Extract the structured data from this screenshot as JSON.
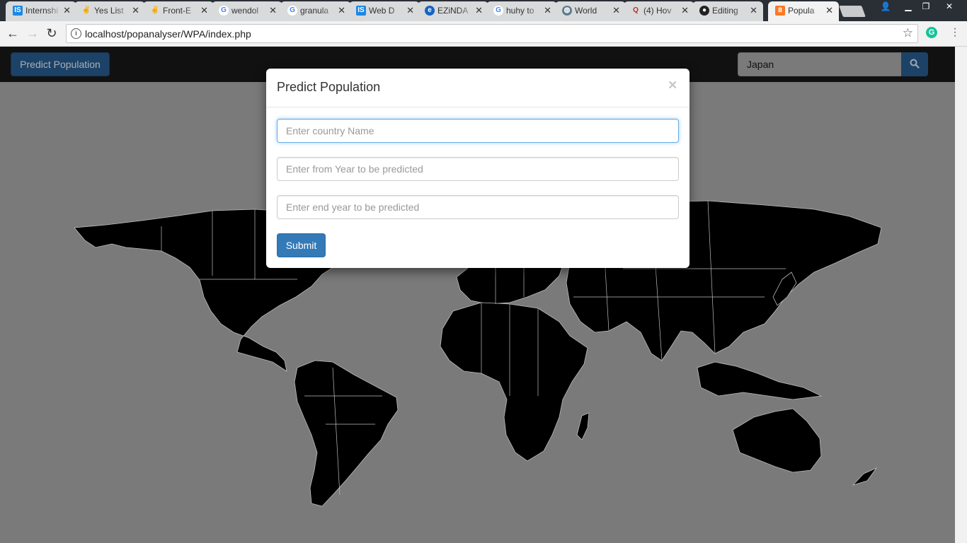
{
  "browser": {
    "tabs": [
      {
        "title": "Internshi",
        "icon": "is-logo-icon",
        "color": "#1e88e5"
      },
      {
        "title": "Yes List",
        "icon": "angellist-icon",
        "color": "#333333"
      },
      {
        "title": "Front-E",
        "icon": "angellist-icon",
        "color": "#333333"
      },
      {
        "title": "wendol",
        "icon": "google-icon",
        "color": "#4285f4"
      },
      {
        "title": "granula",
        "icon": "google-icon",
        "color": "#4285f4"
      },
      {
        "title": "Web D",
        "icon": "is-logo-icon",
        "color": "#1e88e5"
      },
      {
        "title": "EZiNDA",
        "icon": "ezinda-icon",
        "color": "#1565c0"
      },
      {
        "title": "huhy to",
        "icon": "google-icon",
        "color": "#4285f4"
      },
      {
        "title": "World",
        "icon": "globe-icon",
        "color": "#607d8b"
      },
      {
        "title": "(4) Hov",
        "icon": "quora-icon",
        "color": "#b92b27"
      },
      {
        "title": "Editing",
        "icon": "github-icon",
        "color": "#222222"
      },
      {
        "title": "Popula",
        "icon": "xampp-icon",
        "color": "#fb7a24",
        "active": true
      }
    ],
    "url": "localhost/popanalyser/WPA/index.php",
    "extension_letter": "G"
  },
  "navbar": {
    "predict_button": "Predict Population",
    "search_value": "Japan"
  },
  "modal": {
    "title": "Predict Population",
    "close_symbol": "×",
    "country_placeholder": "Enter country Name",
    "from_year_placeholder": "Enter from Year to be predicted",
    "end_year_placeholder": "Enter end year to be predicted",
    "submit_label": "Submit"
  },
  "colors": {
    "primary": "#337ab7",
    "backdrop": "#7a7a7a",
    "land": "#000000",
    "borders": "#bdbdbd"
  }
}
